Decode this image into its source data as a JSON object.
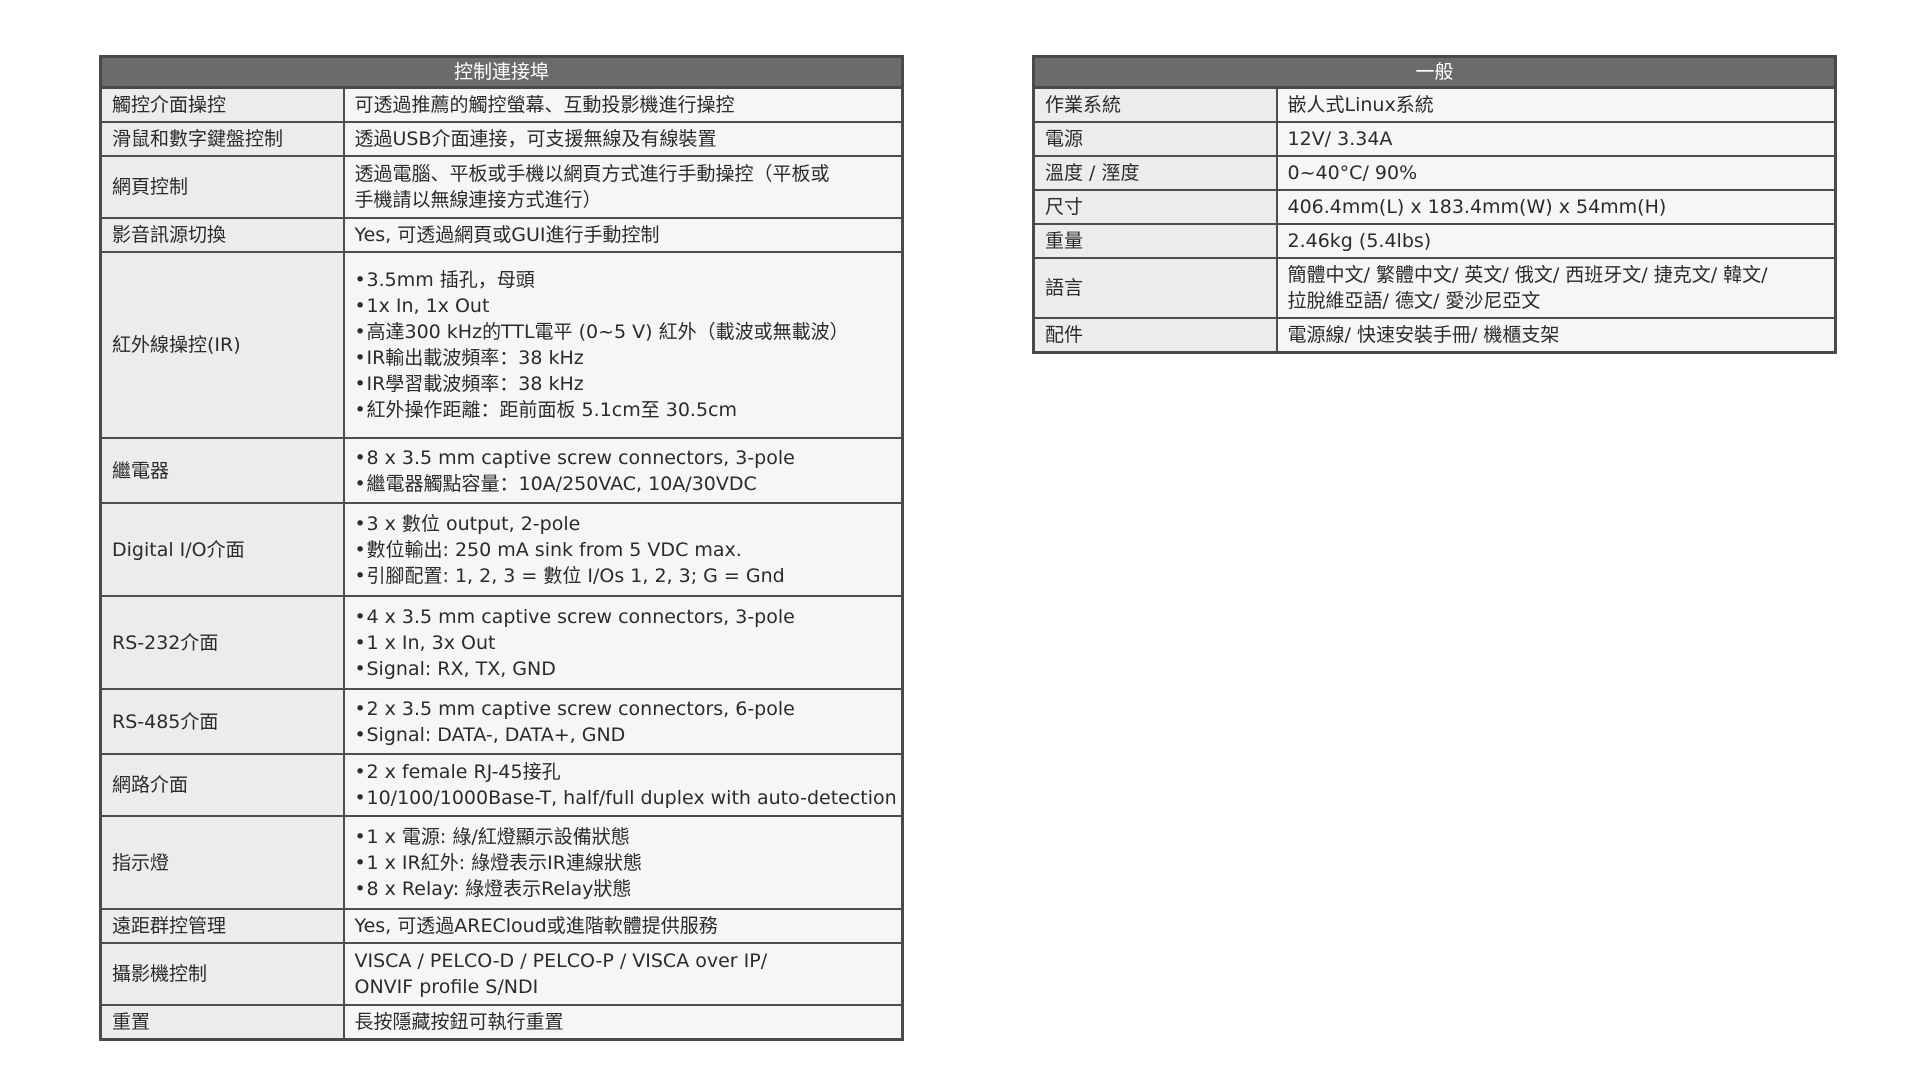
{
  "control_table": {
    "header": "控制連接埠",
    "rows": [
      {
        "label": "觸控介面操控",
        "lines": [
          "可透過推薦的觸控螢幕、互動投影機進行操控"
        ]
      },
      {
        "label": "滑鼠和數字鍵盤控制",
        "lines": [
          "透過USB介面連接，可支援無線及有線裝置"
        ]
      },
      {
        "label": "網頁控制",
        "lines": [
          "透過電腦、平板或手機以網頁方式進行手動操控（平板或",
          "手機請以無線連接方式進行）"
        ]
      },
      {
        "label": "影音訊源切換",
        "lines": [
          "Yes, 可透過網頁或GUI進行手動控制"
        ]
      },
      {
        "label": "紅外線操控(IR)",
        "bullets": [
          "3.5mm 插孔，母頭",
          "1x In, 1x Out",
          "高達300 kHz的TTL電平 (0~5 V) 紅外（載波或無載波）",
          "IR輸出載波頻率：38 kHz",
          "IR學習載波頻率：38 kHz",
          "紅外操作距離：距前面板 5.1cm至 30.5cm"
        ]
      },
      {
        "label": "繼電器",
        "bullets": [
          "8 x 3.5 mm captive screw connectors, 3-pole",
          "繼電器觸點容量：10A/250VAC, 10A/30VDC"
        ]
      },
      {
        "label": "Digital I/O介面",
        "bullets": [
          "3 x 數位 output, 2-pole",
          "數位輸出: 250 mA sink from 5 VDC max.",
          "引腳配置: 1, 2, 3 = 數位 I/Os 1, 2, 3; G = Gnd"
        ]
      },
      {
        "label": "RS-232介面",
        "bullets": [
          "4 x 3.5 mm captive screw connectors, 3-pole",
          "1 x In, 3x Out",
          "Signal: RX, TX, GND"
        ]
      },
      {
        "label": "RS-485介面",
        "bullets": [
          "2 x 3.5 mm captive screw connectors, 6-pole",
          "Signal: DATA-, DATA+, GND"
        ]
      },
      {
        "label": "網路介面",
        "bullets": [
          "2 x female RJ-45接孔",
          "10/100/1000Base-T, half/full duplex with auto-detection"
        ]
      },
      {
        "label": "指示燈",
        "bullets": [
          "1 x 電源: 綠/紅燈顯示設備狀態",
          "1 x IR紅外: 綠燈表示IR連線狀態",
          "8 x Relay: 綠燈表示Relay狀態"
        ]
      },
      {
        "label": "遠距群控管理",
        "lines": [
          "Yes, 可透過ARECloud或進階軟體提供服務"
        ]
      },
      {
        "label": "攝影機控制",
        "lines": [
          "VISCA / PELCO-D / PELCO-P / VISCA over IP/",
          "ONVIF profile S/NDI"
        ]
      },
      {
        "label": "重置",
        "lines": [
          "長按隱藏按鈕可執行重置"
        ]
      }
    ]
  },
  "general_table": {
    "header": "一般",
    "rows": [
      {
        "label": "作業系統",
        "lines": [
          "嵌人式Linux系統"
        ]
      },
      {
        "label": "電源",
        "lines": [
          "12V/ 3.34A"
        ]
      },
      {
        "label": "溫度 / 溼度",
        "lines": [
          "0~40°C/ 90%"
        ]
      },
      {
        "label": "尺寸",
        "lines": [
          "406.4mm(L) x 183.4mm(W) x 54mm(H)"
        ]
      },
      {
        "label": "重量",
        "lines": [
          "2.46kg (5.4lbs)"
        ]
      },
      {
        "label": "語言",
        "lines": [
          "簡體中文/ 繁體中文/ 英文/ 俄文/ 西班牙文/ 捷克文/ 韓文/",
          "拉脫維亞語/ 德文/ 愛沙尼亞文"
        ]
      },
      {
        "label": "配件",
        "lines": [
          "電源線/ 快速安裝手冊/ 機櫃支架"
        ]
      }
    ]
  }
}
